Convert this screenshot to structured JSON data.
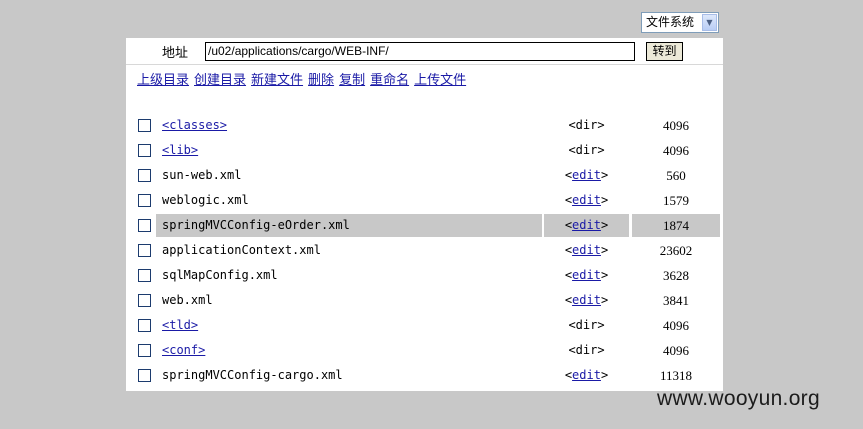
{
  "filesystem_select": {
    "value": "文件系统"
  },
  "address": {
    "label": "地址",
    "value": "/u02/applications/cargo/WEB-INF/",
    "go_label": "转到"
  },
  "toolbar": [
    {
      "label": "上级目录"
    },
    {
      "label": "创建目录"
    },
    {
      "label": "新建文件"
    },
    {
      "label": "删除"
    },
    {
      "label": "复制"
    },
    {
      "label": "重命名"
    },
    {
      "label": "上传文件"
    }
  ],
  "files": [
    {
      "name": "<classes>",
      "is_dir": true,
      "action": "<dir>",
      "size": "4096"
    },
    {
      "name": "<lib>",
      "is_dir": true,
      "action": "<dir>",
      "size": "4096"
    },
    {
      "name": "sun-web.xml",
      "is_dir": false,
      "action": "edit",
      "size": "560"
    },
    {
      "name": "weblogic.xml",
      "is_dir": false,
      "action": "edit",
      "size": "1579"
    },
    {
      "name": "springMVCConfig-eOrder.xml",
      "is_dir": false,
      "action": "edit",
      "size": "1874",
      "highlighted": true
    },
    {
      "name": "applicationContext.xml",
      "is_dir": false,
      "action": "edit",
      "size": "23602"
    },
    {
      "name": "sqlMapConfig.xml",
      "is_dir": false,
      "action": "edit",
      "size": "3628"
    },
    {
      "name": "web.xml",
      "is_dir": false,
      "action": "edit",
      "size": "3841"
    },
    {
      "name": "<tld>",
      "is_dir": true,
      "action": "<dir>",
      "size": "4096"
    },
    {
      "name": "<conf>",
      "is_dir": true,
      "action": "<dir>",
      "size": "4096"
    },
    {
      "name": "springMVCConfig-cargo.xml",
      "is_dir": false,
      "action": "edit",
      "size": "11318"
    }
  ],
  "watermark": "www.wooyun.org"
}
